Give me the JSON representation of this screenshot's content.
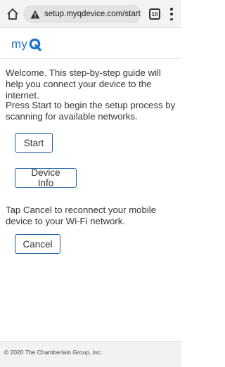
{
  "browser": {
    "url": "setup.myqdevice.com/start.htm",
    "tab_count": "10",
    "icons": [
      "home-icon",
      "warning-icon",
      "tabs-icon",
      "menu-icon"
    ]
  },
  "header": {
    "logo_text": "myQ",
    "brand_color": "#1a73c8"
  },
  "main": {
    "welcome_text": "Welcome. This step-by-step guide will help you connect your device to the internet.",
    "start_instructions": "Press Start to begin the setup process by scanning for available networks.",
    "start_button": "Start",
    "device_info_button": "Device Info",
    "cancel_instructions": "Tap Cancel to reconnect your mobile device to your Wi-Fi network.",
    "cancel_button": "Cancel",
    "button_border_color": "#1f5f9f"
  },
  "footer": {
    "copyright": "© 2020 The Chamberlain Group, Inc."
  }
}
